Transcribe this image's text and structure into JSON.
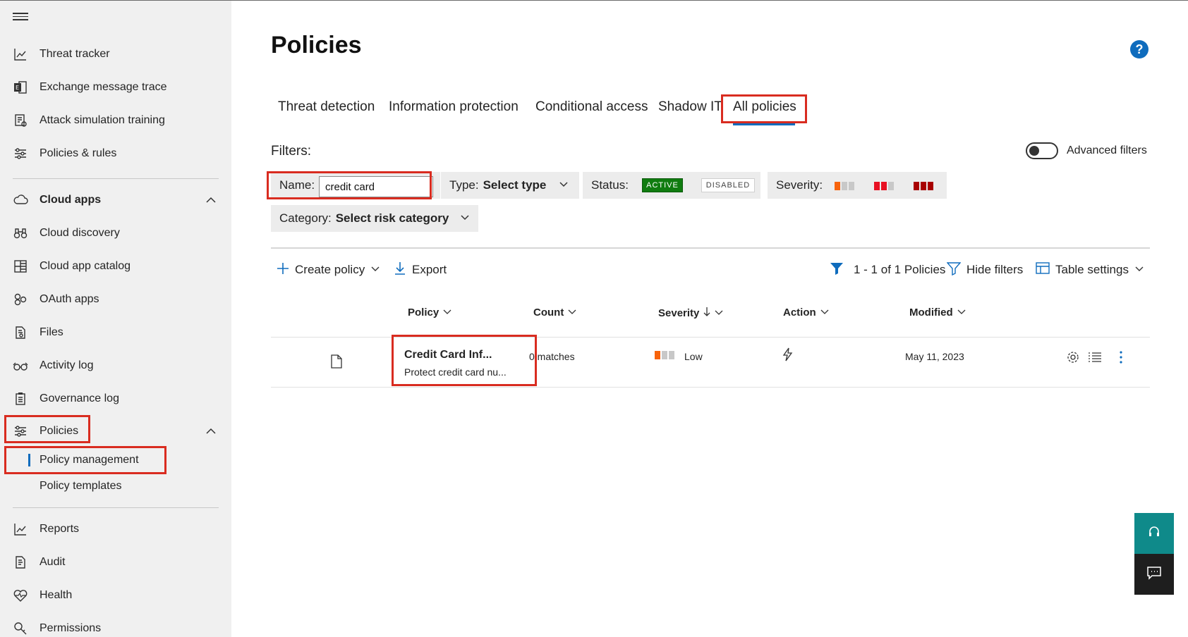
{
  "sidebar": {
    "items": [
      {
        "label": "Threat tracker",
        "icon": "chart-line-icon"
      },
      {
        "label": "Exchange message trace",
        "icon": "exchange-icon"
      },
      {
        "label": "Attack simulation training",
        "icon": "simulation-icon"
      },
      {
        "label": "Policies & rules",
        "icon": "sliders-icon"
      }
    ],
    "cloud_apps": {
      "label": "Cloud apps",
      "items": [
        {
          "label": "Cloud discovery",
          "icon": "binoculars-icon"
        },
        {
          "label": "Cloud app catalog",
          "icon": "grid-icon"
        },
        {
          "label": "OAuth apps",
          "icon": "apps-icon"
        },
        {
          "label": "Files",
          "icon": "document-search-icon"
        },
        {
          "label": "Activity log",
          "icon": "glasses-icon"
        },
        {
          "label": "Governance log",
          "icon": "clipboard-icon"
        }
      ]
    },
    "policies": {
      "label": "Policies",
      "sub": [
        "Policy management",
        "Policy templates"
      ]
    },
    "bottom_items": [
      {
        "label": "Reports",
        "icon": "chart-line-icon"
      },
      {
        "label": "Audit",
        "icon": "audit-icon"
      },
      {
        "label": "Health",
        "icon": "heart-pulse-icon"
      },
      {
        "label": "Permissions",
        "icon": "key-icon"
      }
    ]
  },
  "page": {
    "title": "Policies",
    "help": "?"
  },
  "tabs": [
    "Threat detection",
    "Information protection",
    "Conditional access",
    "Shadow IT",
    "All policies"
  ],
  "filters": {
    "label": "Filters:",
    "advanced_label": "Advanced filters",
    "name_key": "Name:",
    "name_value": "credit card",
    "type_key": "Type:",
    "type_value": "Select type",
    "status_key": "Status:",
    "status_active": "ACTIVE",
    "status_disabled": "DISABLED",
    "severity_key": "Severity:",
    "category_key": "Category:",
    "category_value": "Select risk category"
  },
  "toolbar": {
    "create": "Create policy",
    "export": "Export",
    "count": "1 - 1 of 1 Policies",
    "hide_filters": "Hide filters",
    "table_settings": "Table settings"
  },
  "table": {
    "headers": [
      "Policy",
      "Count",
      "Severity",
      "Action",
      "Modified"
    ],
    "rows": [
      {
        "name": "Credit Card Inf...",
        "description": "Protect credit card nu...",
        "count": "0 matches",
        "severity": "Low",
        "modified": "May 11, 2023"
      }
    ]
  },
  "colors": {
    "accent": "#0f6cbd",
    "highlight": "#d92c20",
    "active_green": "#107c10",
    "sev_low": "#f7630c",
    "sev_med": "#e81123",
    "sev_high": "#a80000"
  }
}
